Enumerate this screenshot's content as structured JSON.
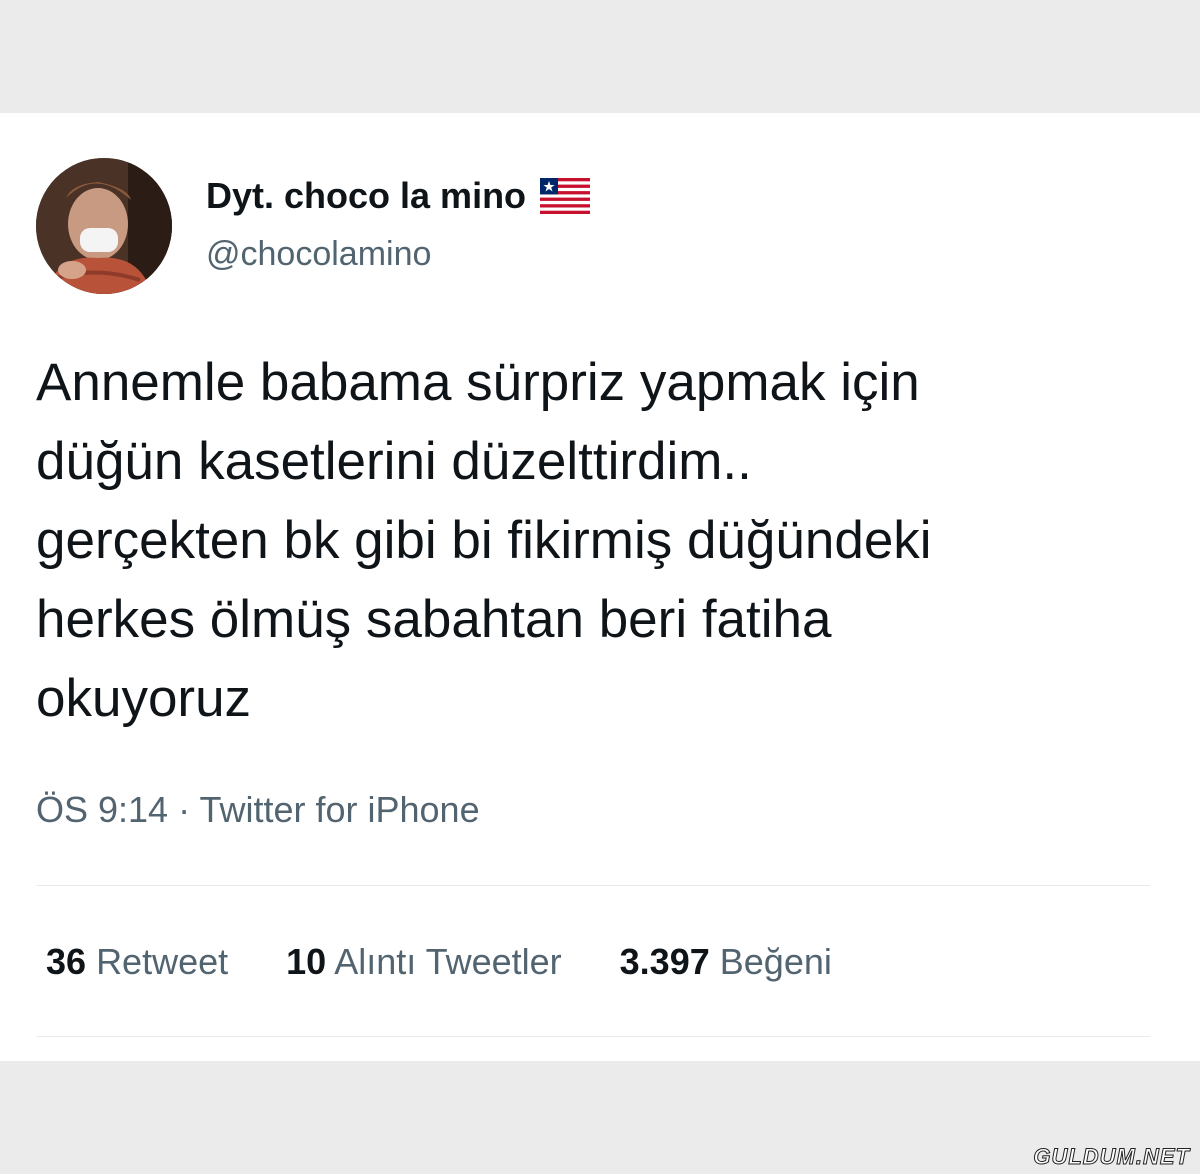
{
  "author": {
    "display_name": "Dyt. choco la mino",
    "handle": "@chocolamino",
    "flag_icon": "liberia-flag-emoji"
  },
  "tweet": {
    "lines": [
      "Annemle babama sürpriz yapmak için",
      "düğün kasetlerini düzelttirdim..",
      "gerçekten bk gibi bi fikirmiş düğündeki",
      "herkes ölmüş sabahtan beri fatiha",
      "okuyoruz"
    ],
    "time": "ÖS 9:14",
    "separator": "·",
    "source": "Twitter for iPhone"
  },
  "stats": {
    "retweets": {
      "count": "36",
      "label": "Retweet"
    },
    "quotes": {
      "count": "10",
      "label": "Alıntı Tweetler"
    },
    "likes": {
      "count": "3.397",
      "label": "Beğeni"
    }
  },
  "watermark": "GULDUM.NET",
  "colors": {
    "text_primary": "#0f1419",
    "text_secondary": "#536471",
    "background": "#ebebeb",
    "card": "#ffffff"
  }
}
